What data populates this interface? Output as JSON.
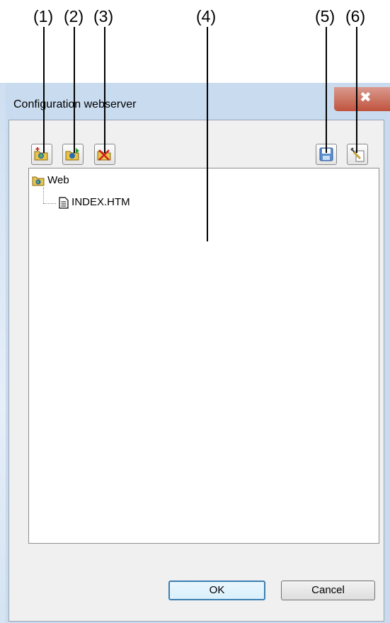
{
  "callouts": {
    "c1": "(1)",
    "c2": "(2)",
    "c3": "(3)",
    "c4": "(4)",
    "c5": "(5)",
    "c6": "(6)"
  },
  "window": {
    "title": "Configuration webserver",
    "close_glyph": "✖"
  },
  "toolbar": {
    "buttons": [
      {
        "name": "add-folder",
        "icon": "folder-add-icon"
      },
      {
        "name": "add-file",
        "icon": "folder-import-icon"
      },
      {
        "name": "delete",
        "icon": "folder-delete-icon"
      },
      {
        "name": "save",
        "icon": "save-icon"
      },
      {
        "name": "properties",
        "icon": "properties-icon"
      }
    ]
  },
  "tree": {
    "root_label": "Web",
    "child_label": "INDEX.HTM"
  },
  "buttons": {
    "ok_label": "OK",
    "cancel_label": "Cancel"
  },
  "colors": {
    "titlebar": "#c9dbee",
    "close": "#c0533d",
    "ok_border": "#3c7fb1"
  }
}
